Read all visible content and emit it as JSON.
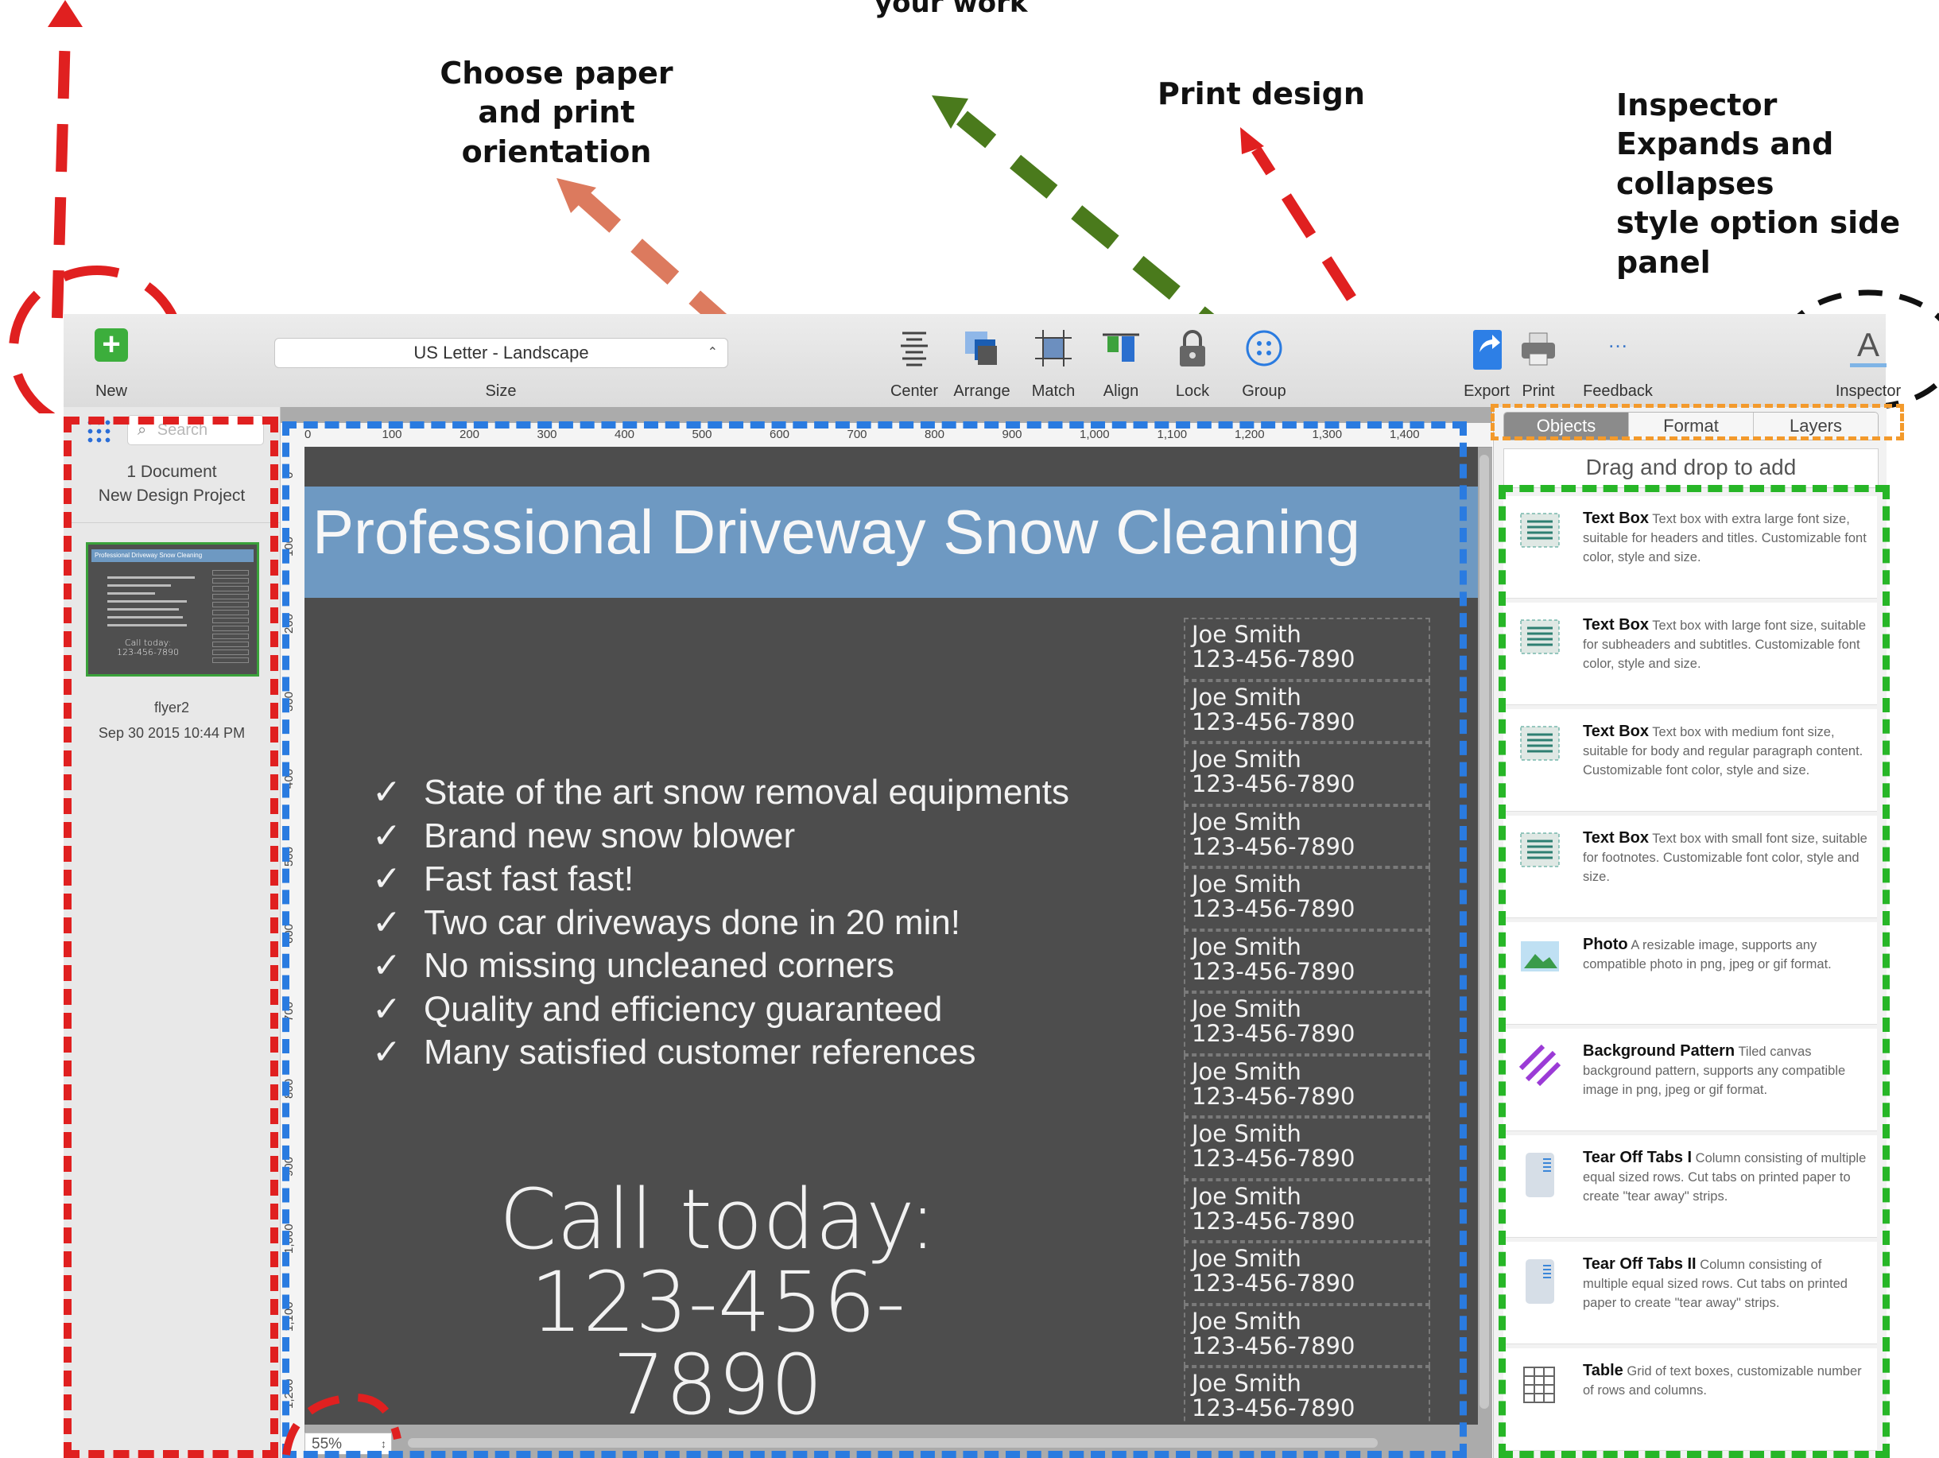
{
  "annotations": {
    "top_cut": "your work",
    "paper": "Choose paper and print orientation",
    "print_design": "Print design",
    "inspector_title": "Inspector",
    "inspector_line2": "Expands and collapses",
    "inspector_line3": "style option side panel"
  },
  "toolbar": {
    "new_label": "New",
    "size_value": "US Letter - Landscape",
    "size_label": "Size",
    "center_label": "Center",
    "arrange_label": "Arrange",
    "match_label": "Match",
    "align_label": "Align",
    "lock_label": "Lock",
    "group_label": "Group",
    "export_label": "Export",
    "print_label": "Print",
    "feedback_label": "Feedback",
    "inspector_label": "Inspector",
    "inspector_glyph": "A"
  },
  "sidebar": {
    "search_placeholder": "Search",
    "doc_count": "1 Document",
    "project_name": "New Design Project",
    "thumb_title": "Professional Driveway Snow Cleaning",
    "thumb_call": "Call today:",
    "thumb_phone": "123-456-7890",
    "file_name": "flyer2",
    "file_date": "Sep 30 2015 10:44 PM"
  },
  "rulers": {
    "h_ticks": [
      "0",
      "100",
      "200",
      "300",
      "400",
      "500",
      "600",
      "700",
      "800",
      "900",
      "1,000",
      "1,100",
      "1,200",
      "1,300",
      "1,400"
    ],
    "v_ticks": [
      "0",
      "100",
      "200",
      "300",
      "400",
      "500",
      "600",
      "700",
      "800",
      "900",
      "1,000",
      "1,100",
      "1,200"
    ]
  },
  "flyer": {
    "title": "Professional Driveway Snow Cleaning",
    "check": "✓",
    "bullets": [
      "State of the art snow removal equipments",
      "Brand new snow blower",
      "Fast fast fast!",
      "Two car driveways done in 20 min!",
      "No missing uncleaned corners",
      "Quality and efficiency guaranteed",
      "Many satisfied customer references"
    ],
    "call_line1": "Call today:",
    "call_line2": "123-456-7890",
    "tab_name": "Joe Smith",
    "tab_phone": "123-456-7890",
    "tab_count": 13
  },
  "canvas": {
    "zoom": "55%"
  },
  "inspector": {
    "tabs": [
      "Objects",
      "Format",
      "Layers"
    ],
    "active_tab": "Objects",
    "drag_hint": "Drag and drop to add",
    "objects": [
      {
        "name": "Text Box",
        "desc": "Text box with extra large font size, suitable for headers and titles. Customizable font color, style and size.",
        "icon": "text-box-icon"
      },
      {
        "name": "Text Box",
        "desc": "Text box with large font size, suitable for subheaders and subtitles. Customizable font color, style and size.",
        "icon": "text-box-icon"
      },
      {
        "name": "Text Box",
        "desc": "Text box with medium font size, suitable for body and regular paragraph content. Customizable font color, style and size.",
        "icon": "text-box-icon"
      },
      {
        "name": "Text Box",
        "desc": "Text box with small font size, suitable for footnotes. Customizable font color, style and size.",
        "icon": "text-box-icon"
      },
      {
        "name": "Photo",
        "desc": "A resizable image, supports any compatible photo in png, jpeg or gif format.",
        "icon": "photo-icon"
      },
      {
        "name": "Background Pattern",
        "desc": "Tiled canvas background pattern, supports any compatible image in png, jpeg or gif format.",
        "icon": "pattern-icon"
      },
      {
        "name": "Tear Off Tabs I",
        "desc": "Column consisting of multiple equal sized rows.  Cut tabs on printed paper to create \"tear away\" strips.",
        "icon": "tear-off-icon"
      },
      {
        "name": "Tear Off Tabs II",
        "desc": "Column consisting of multiple equal sized rows.  Cut tabs on printed paper to create \"tear away\" strips.",
        "icon": "tear-off-icon"
      },
      {
        "name": "Table",
        "desc": "Grid of text boxes, customizable number of rows and columns.",
        "icon": "table-icon"
      }
    ]
  },
  "colors": {
    "red": "#e02020",
    "green_dash": "#27b627",
    "blue_dash": "#2a7be0",
    "orange_dash": "#f39a2c",
    "brown_arrow": "#dc7a5e",
    "olive_arrow": "#4a7a1c",
    "title_band": "#6e99c2",
    "page_bg": "#4d4d4d"
  }
}
